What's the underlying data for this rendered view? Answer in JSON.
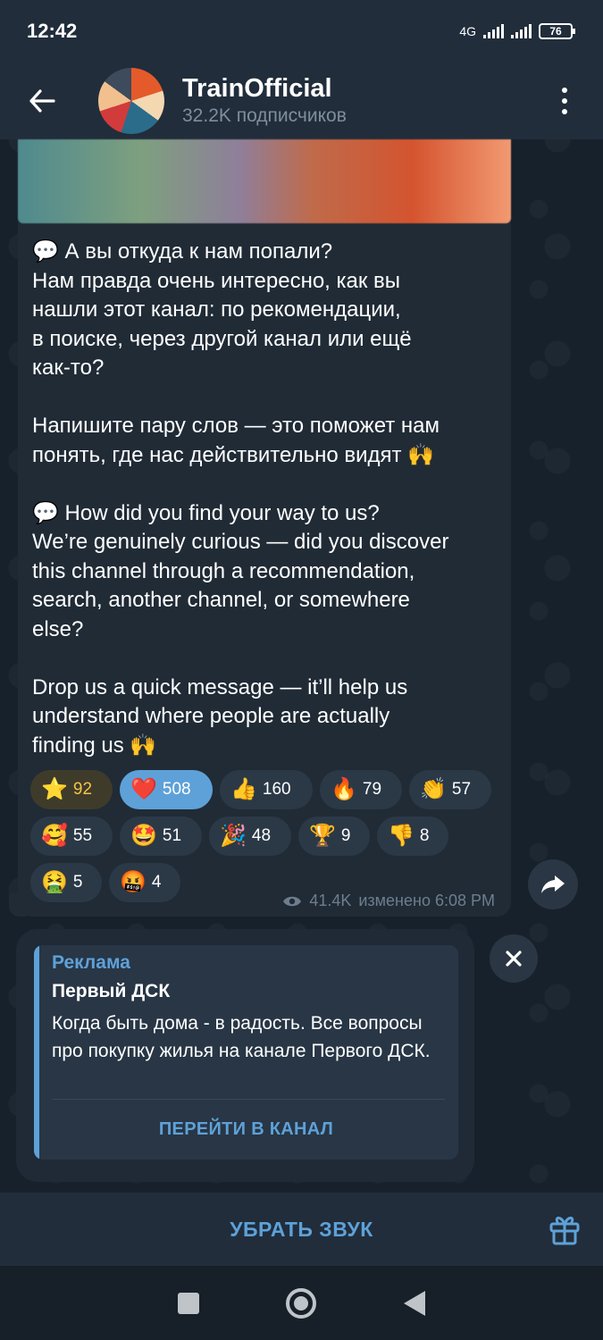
{
  "status_bar": {
    "time": "12:42",
    "network": "4G",
    "battery": "76"
  },
  "header": {
    "channel_name": "TrainOfficial",
    "subscribers": "32.2K подписчиков"
  },
  "message": {
    "text": "💬 А вы откуда к нам попали?\nНам правда очень интересно, как вы\nнашли этот канал: по рекомендации,\nв поиске, через другой канал или ещё\nкак-то?\n\nНапишите пару слов — это поможет нам\nпонять, где нас действительно видят 🙌\n\n💬 How did you find your way to us?\nWe’re genuinely curious — did you discover\nthis channel through a recommendation,\nsearch, another channel, or somewhere\nelse?\n\nDrop us a quick message — it’ll help us\nunderstand where people are actually\nfinding us 🙌",
    "reactions": [
      {
        "emoji": "⭐",
        "count": "92"
      },
      {
        "emoji": "❤️",
        "count": "508"
      },
      {
        "emoji": "👍",
        "count": "160"
      },
      {
        "emoji": "🔥",
        "count": "79"
      },
      {
        "emoji": "👏",
        "count": "57"
      },
      {
        "emoji": "🥰",
        "count": "55"
      },
      {
        "emoji": "🤩",
        "count": "51"
      },
      {
        "emoji": "🎉",
        "count": "48"
      },
      {
        "emoji": "🏆",
        "count": "9"
      },
      {
        "emoji": "👎",
        "count": "8"
      },
      {
        "emoji": "🤮",
        "count": "5"
      },
      {
        "emoji": "🤬",
        "count": "4"
      }
    ],
    "views": "41.4K",
    "edited_time": "изменено 6:08 PM"
  },
  "ad": {
    "label": "Реклама",
    "title": "Первый ДСК",
    "description": "Когда быть дома - в радость. Все вопросы про покупку жилья на канале Первого ДСК.",
    "action": "ПЕРЕЙТИ В КАНАЛ"
  },
  "bottom_bar": {
    "mute_label": "УБРАТЬ ЗВУК"
  },
  "colors": {
    "accent": "#5ea1d8",
    "bubble": "#202b36",
    "header": "#212d3b"
  }
}
